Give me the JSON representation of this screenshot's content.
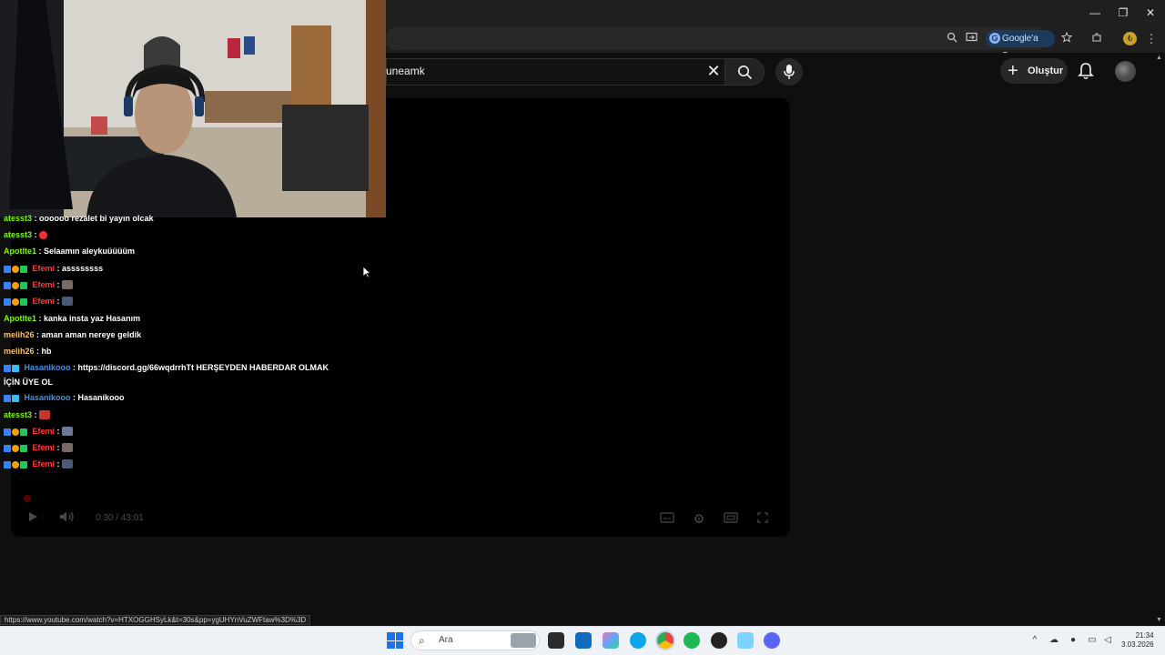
{
  "browser": {
    "google_ask_label": "Google'a Sor",
    "window_controls": [
      "—",
      "❐",
      "✕"
    ]
  },
  "youtube": {
    "search_query": "uneamk",
    "create_label": "Oluştur"
  },
  "player": {
    "time": "0:30 / 43:01"
  },
  "chat": {
    "messages": [
      {
        "user": "atesst3",
        "text": ": oooooo rezalet bi yayın olcak",
        "color": "green"
      },
      {
        "user": "atesst3",
        "text": ":",
        "color": "green",
        "emote": "#ff2d2d"
      },
      {
        "user": "Apotlte1",
        "text": ": Selaamın aleykuüüüüm",
        "color": "green"
      },
      {
        "user": "Efemi",
        "text": ": assssssss",
        "color": "red",
        "badges": true
      },
      {
        "user": "Efemi",
        "text": ":",
        "color": "red",
        "badges": true,
        "emote": "#7a6a66"
      },
      {
        "user": "Efemi",
        "text": ":",
        "color": "red",
        "badges": true,
        "emote": "#4c5a78"
      },
      {
        "user": "Apotlte1",
        "text": ": kanka insta yaz Hasanım",
        "color": "green"
      },
      {
        "user": "melih26",
        "text": ": aman aman nereye geldik",
        "color": "orange"
      },
      {
        "user": "melih26",
        "text": ": hb",
        "color": "orange"
      },
      {
        "user": "Hasanikooo",
        "text": ": https://discord.gg/66wqdrrhTt HERŞEYDEN HABERDAR OLMAK",
        "color": "blue",
        "badges2": true
      },
      {
        "user": "",
        "text": "İÇİN ÜYE OL",
        "color": "white"
      },
      {
        "user": "Hasanikooo",
        "text": ": Hasanikooo",
        "color": "blue",
        "badges2": true
      },
      {
        "user": "atesst3",
        "text": ":",
        "color": "green",
        "emote": "#c0392b"
      },
      {
        "user": "Efemi",
        "text": ":",
        "color": "red",
        "badges": true,
        "emote": "#6b7a96"
      },
      {
        "user": "Efemi",
        "text": ":",
        "color": "red",
        "badges": true,
        "emote": "#7a6a66"
      },
      {
        "user": "Efemi",
        "text": ":",
        "color": "red",
        "badges": true,
        "emote": "#4c5a78"
      }
    ]
  },
  "status_url": "https://www.youtube.com/watch?v=HTXOGGHSyLk&t=30s&pp=ygUHYnVuZWFtaw%3D%3D",
  "taskbar": {
    "search_placeholder": "Ara",
    "time": "21:34",
    "date": "3.03.2026"
  }
}
